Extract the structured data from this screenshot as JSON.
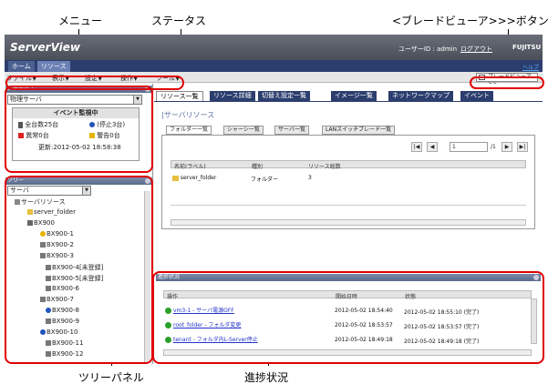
{
  "annotations": {
    "menu": "メニュー",
    "status": "ステータス",
    "blade_button": "<ブレードビューア>>>ボタン",
    "tree_panel": "ツリーパネル",
    "progress": "進捗状況"
  },
  "header": {
    "app_title": "ServerView",
    "user_label": "ユーザーID : admin",
    "logout": "ログアウト",
    "brand": "FUJITSU",
    "help": "ヘルプ"
  },
  "top_tabs": [
    "ホーム",
    "リソース"
  ],
  "menu": [
    "ファイル▼",
    "表示▼",
    "設定▼",
    "操作▼",
    "ツール▼"
  ],
  "blade_viewer_button": "ブレードビューア>>",
  "status_panel": {
    "header": "ステータス",
    "select_value": "物理サーバ",
    "event_monitor": "イベント監視中",
    "total": "全台数25台",
    "stopped": "(停止3台)",
    "error": "異常0台",
    "warning": "警告0台",
    "updated": "更新:2012-05-02 18:58:38"
  },
  "tree_panel": {
    "header": "ツリー",
    "select_value": "サーバ",
    "items": [
      "サーバリソース",
      "server_folder",
      "BX900",
      "BX900-1",
      "BX900-2",
      "BX900-3",
      "BX900-4[未登録]",
      "BX900-5[未登録]",
      "BX900-6",
      "BX900-7",
      "BX900-8",
      "BX900-9",
      "BX900-10",
      "BX900-11",
      "BX900-12"
    ]
  },
  "main_tabs": [
    "リソース一覧",
    "リソース詳細",
    "切替え設定一覧",
    "イメージ一覧",
    "ネットワークマップ",
    "イベント"
  ],
  "resource_section": {
    "title": "|サーバリソース",
    "subtabs": [
      "フォルダー一覧",
      "シャーシ一覧",
      "サーバ一覧",
      "LANスイッチブレード一覧"
    ],
    "page_value": "1",
    "page_total": "/1",
    "columns": [
      "名前(ラベル)",
      "種別",
      "リソース総数"
    ],
    "rows": [
      {
        "name": "server_folder",
        "type": "フォルダー",
        "count": "3"
      }
    ]
  },
  "progress_panel": {
    "header": "進捗状況",
    "columns": [
      "操作",
      "開始日時",
      "状態"
    ],
    "rows": [
      {
        "op": "vm3-1 - サーバ電源OFF",
        "start": "2012-05-02 18:54:40",
        "status": "2012-05-02 18:55:10 (完了)"
      },
      {
        "op": "root_folder - フォルダ変更",
        "start": "2012-05-02 18:53:57",
        "status": "2012-05-02 18:53:57 (完了)"
      },
      {
        "op": "tenant - フォルダ内L-Server停止",
        "start": "2012-05-02 18:49:18",
        "status": "2012-05-02 18:49:18 (完了)"
      }
    ]
  },
  "colors": {
    "annotation_red": "#e00000",
    "tab_blue": "#2c3e6e",
    "link_blue": "#2233cc",
    "ok_green": "#2aa02a"
  }
}
